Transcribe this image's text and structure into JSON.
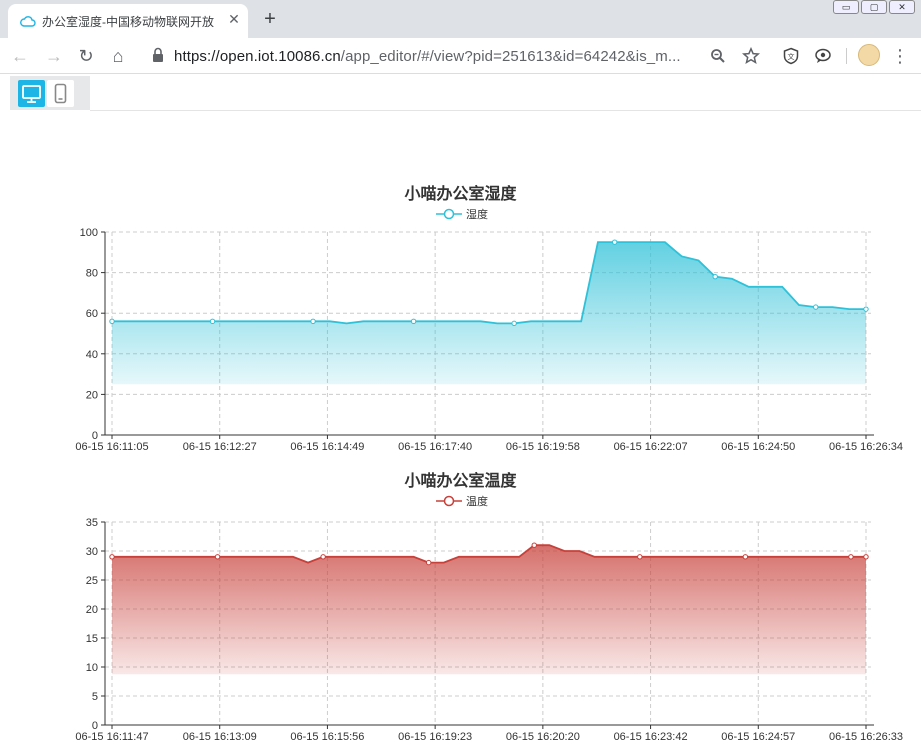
{
  "browser": {
    "tab_title": "办公室湿度-中国移动物联网开放",
    "close_glyph": "✕",
    "newtab_glyph": "+",
    "url_host": "https://open.iot.10086.cn",
    "url_path": "/app_editor/#/view?pid=251613&id=64242&is_m...",
    "nav": {
      "back": "←",
      "forward": "→",
      "reload": "↻",
      "home": "⌂"
    },
    "icons": {
      "zoom": "zoom-icon",
      "star": "star-icon",
      "ext1": "translate-extension-icon",
      "ext2": "reader-extension-icon",
      "menu": "⋮"
    },
    "window_controls": [
      "▭",
      "▢",
      "✕"
    ]
  },
  "accent": "#1db5e6",
  "charts": [
    {
      "title": "小喵办公室湿度",
      "legend": "湿度",
      "color": "#2ec1d8"
    },
    {
      "title": "小喵办公室温度",
      "legend": "温度",
      "color": "#c8403a"
    }
  ],
  "chart_data": [
    {
      "type": "area",
      "title": "小喵办公室湿度",
      "series": [
        {
          "name": "湿度",
          "values": [
            56,
            56,
            56,
            56,
            56,
            56,
            56,
            56,
            56,
            56,
            56,
            56,
            56,
            56,
            55,
            56,
            56,
            56,
            56,
            56,
            56,
            56,
            56,
            55,
            55,
            56,
            56,
            56,
            56,
            95,
            95,
            95,
            95,
            95,
            88,
            86,
            78,
            77,
            73,
            73,
            73,
            64,
            63,
            63,
            62,
            62
          ]
        }
      ],
      "xlim_points": 46,
      "xticks": [
        "06-15 16:11:05",
        "06-15 16:12:27",
        "06-15 16:14:49",
        "06-15 16:17:40",
        "06-15 16:19:58",
        "06-15 16:22:07",
        "06-15 16:24:50",
        "06-15 16:26:34"
      ],
      "ylim": [
        0,
        100
      ],
      "yticks": [
        0,
        20,
        40,
        60,
        80,
        100
      ],
      "grid": true,
      "legend_position": "top-center"
    },
    {
      "type": "area",
      "title": "小喵办公室温度",
      "series": [
        {
          "name": "温度",
          "values": [
            29,
            29,
            29,
            29,
            29,
            29,
            29,
            29,
            29,
            29,
            29,
            29,
            29,
            28,
            29,
            29,
            29,
            29,
            29,
            29,
            29,
            28,
            28,
            29,
            29,
            29,
            29,
            29,
            31,
            31,
            30,
            30,
            29,
            29,
            29,
            29,
            29,
            29,
            29,
            29,
            29,
            29,
            29,
            29,
            29,
            29,
            29,
            29,
            29,
            29,
            29
          ]
        }
      ],
      "xlim_points": 51,
      "xticks": [
        "06-15 16:11:47",
        "06-15 16:13:09",
        "06-15 16:15:56",
        "06-15 16:19:23",
        "06-15 16:20:20",
        "06-15 16:23:42",
        "06-15 16:24:57",
        "06-15 16:26:33"
      ],
      "ylim": [
        0,
        35
      ],
      "yticks": [
        0,
        5,
        10,
        15,
        20,
        25,
        30,
        35
      ],
      "grid": true,
      "legend_position": "top-center"
    }
  ]
}
